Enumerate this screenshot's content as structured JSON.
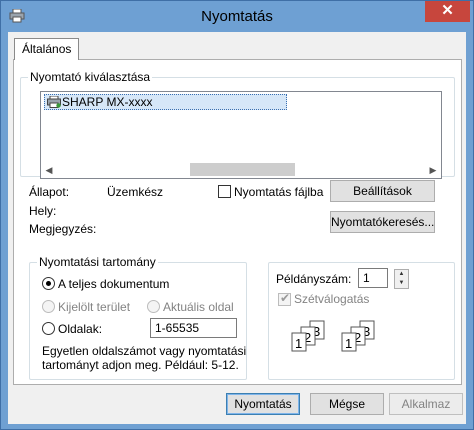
{
  "window": {
    "title": "Nyomtatás",
    "close_label": "✕"
  },
  "tabs": [
    {
      "label": "Általános"
    }
  ],
  "printer_select": {
    "group_title": "Nyomtató kiválasztása",
    "selected_printer": "SHARP MX-xxxx",
    "print_to_file_label": "Nyomtatás fájlba",
    "preferences_button": "Beállítások",
    "find_printer_button": "Nyomtatókeresés..."
  },
  "status": {
    "status_label": "Állapot:",
    "status_value": "Üzemkész",
    "location_label": "Hely:",
    "location_value": "",
    "comment_label": "Megjegyzés:",
    "comment_value": ""
  },
  "page_range": {
    "group_title": "Nyomtatási tartomány",
    "all_label": "A teljes dokumentum",
    "selection_label": "Kijelölt terület",
    "current_page_label": "Aktuális oldal",
    "pages_label": "Oldalak:",
    "pages_value": "1-65535",
    "help_line1": "Egyetlen oldalszámot vagy nyomtatási",
    "help_line2": "tartományt adjon meg. Például: 5-12.",
    "selected": "all"
  },
  "copies": {
    "copies_label": "Példányszám:",
    "copies_value": "1",
    "collate_label": "Szétválogatás",
    "collate_checked": true,
    "collate_enabled": false
  },
  "footer": {
    "print_button": "Nyomtatás",
    "cancel_button": "Mégse",
    "apply_button": "Alkalmaz"
  },
  "colors": {
    "title_bar": "#6ea0d3",
    "close_button": "#c7463d",
    "selection": "#d6e7f8"
  }
}
